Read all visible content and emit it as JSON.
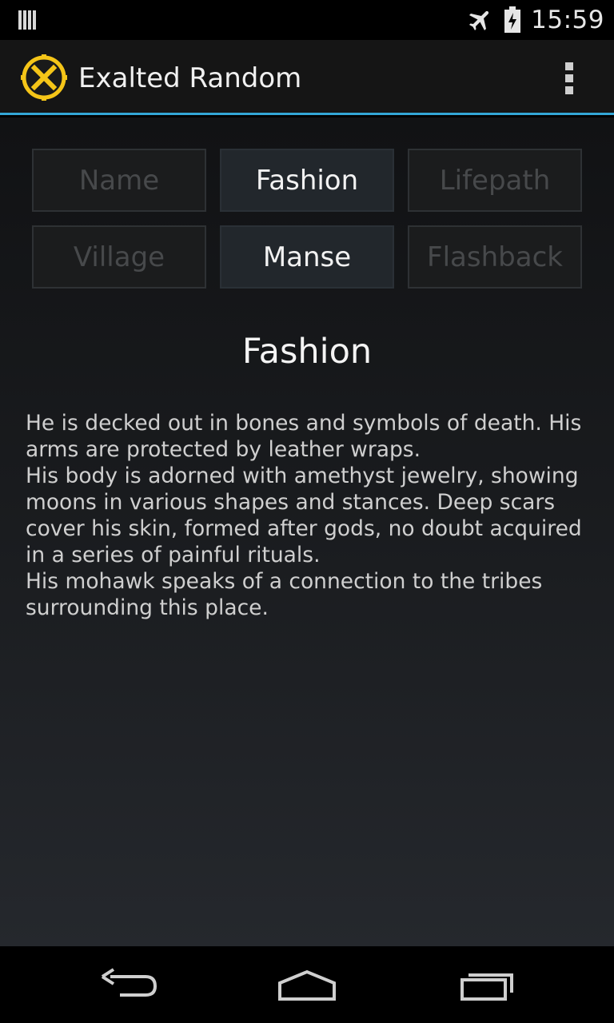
{
  "status_bar": {
    "time": "15:59",
    "icons": [
      "notification-icon",
      "airplane-icon",
      "battery-charging-icon"
    ]
  },
  "app_bar": {
    "title": "Exalted Random",
    "logo_icon": "exalted-x-icon",
    "menu_icon": "overflow-menu-icon"
  },
  "tabs": [
    {
      "label": "Name",
      "active": false
    },
    {
      "label": "Fashion",
      "active": true
    },
    {
      "label": "Lifepath",
      "active": false
    },
    {
      "label": "Village",
      "active": false
    },
    {
      "label": "Manse",
      "active": true
    },
    {
      "label": "Flashback",
      "active": false
    }
  ],
  "main": {
    "title": "Fashion",
    "paragraphs": [
      "He is decked out in bones and symbols of death. His arms are protected by leather wraps.",
      "His body is adorned with amethyst jewelry, showing moons in various shapes and stances. Deep scars cover his skin, formed after gods, no doubt acquired in a series of painful rituals.",
      "His mohawk speaks of a connection to the tribes surrounding this place."
    ]
  },
  "nav_bar": {
    "icons": [
      "back-icon",
      "home-icon",
      "recent-apps-icon"
    ]
  },
  "colors": {
    "accent": "#33a6d6",
    "logo": "#f5c518"
  }
}
